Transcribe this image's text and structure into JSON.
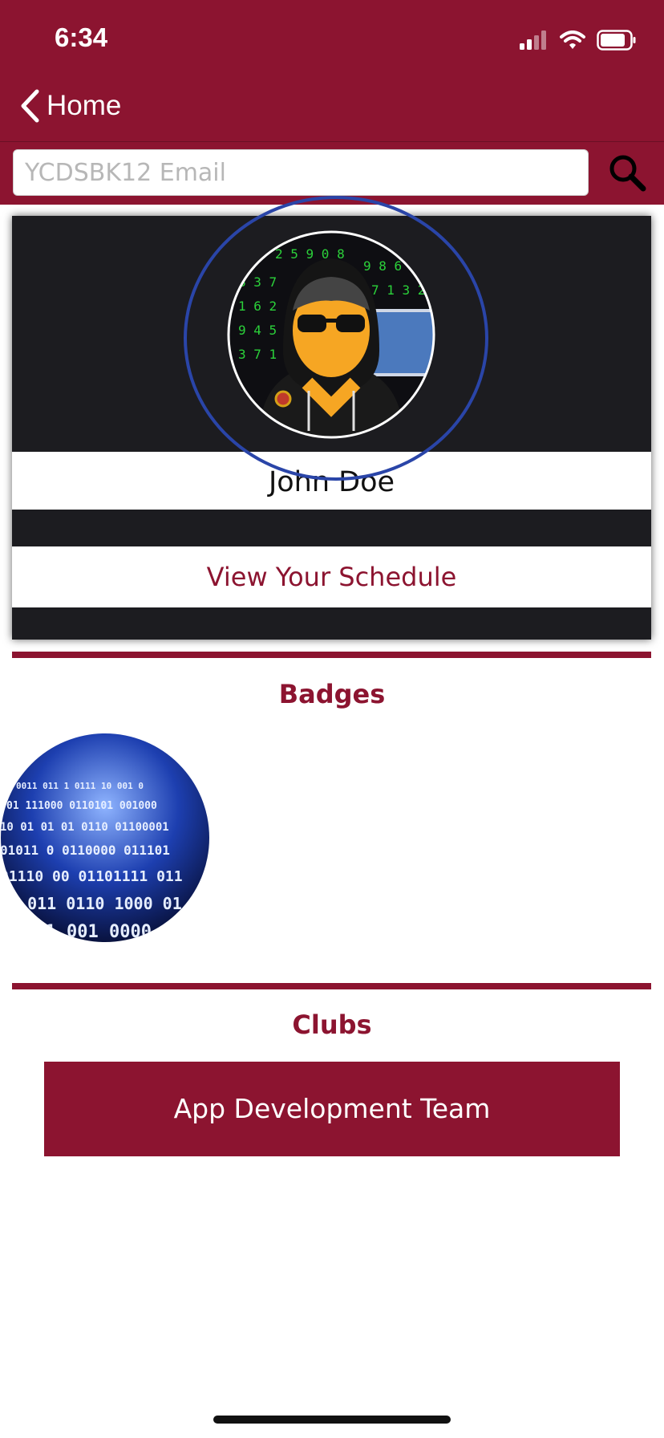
{
  "status_bar": {
    "time": "6:34"
  },
  "nav": {
    "back_label": "Home"
  },
  "search": {
    "placeholder": "YCDSBK12 Email"
  },
  "profile": {
    "name": "John Doe",
    "schedule_link": "View Your Schedule"
  },
  "badges": {
    "title": "Badges",
    "items": [
      {
        "icon": "binary-code-badge"
      }
    ]
  },
  "clubs": {
    "title": "Clubs",
    "items": [
      {
        "label": "App Development Team"
      }
    ]
  },
  "colors": {
    "brand": "#8c1430",
    "card_bg": "#1c1c20",
    "highlight": "#2a45a8"
  }
}
